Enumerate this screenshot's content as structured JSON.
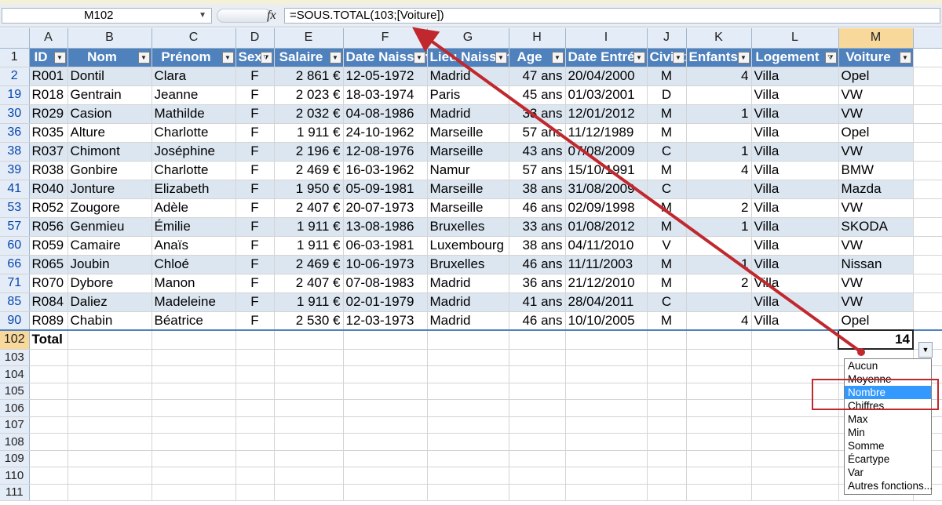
{
  "formula_bar": {
    "name_box": "M102",
    "fx_icon": "fx",
    "formula": "=SOUS.TOTAL(103;[Voiture])"
  },
  "columns": [
    "A",
    "B",
    "C",
    "D",
    "E",
    "F",
    "G",
    "H",
    "I",
    "J",
    "K",
    "L",
    "M"
  ],
  "header_row": {
    "row_number": "1",
    "labels": [
      "ID",
      "Nom",
      "Prénom",
      "Sexe",
      "Salaire",
      "Date Naissance",
      "Lieu Naissance",
      "Age",
      "Date Entrée",
      "Civilité",
      "Enfants",
      "Logement",
      "Voiture"
    ]
  },
  "rows": [
    {
      "row": "2",
      "cells": [
        "R001",
        "Dontil",
        "Clara",
        "F",
        "2 861 €",
        "12-05-1972",
        "Madrid",
        "47 ans",
        "20/04/2000",
        "M",
        "4",
        "Villa",
        "Opel"
      ]
    },
    {
      "row": "19",
      "cells": [
        "R018",
        "Gentrain",
        "Jeanne",
        "F",
        "2 023 €",
        "18-03-1974",
        "Paris",
        "45 ans",
        "01/03/2001",
        "D",
        "",
        "Villa",
        "VW"
      ]
    },
    {
      "row": "30",
      "cells": [
        "R029",
        "Casion",
        "Mathilde",
        "F",
        "2 032 €",
        "04-08-1986",
        "Madrid",
        "33 ans",
        "12/01/2012",
        "M",
        "1",
        "Villa",
        "VW"
      ]
    },
    {
      "row": "36",
      "cells": [
        "R035",
        "Alture",
        "Charlotte",
        "F",
        "1 911 €",
        "24-10-1962",
        "Marseille",
        "57 ans",
        "11/12/1989",
        "M",
        "",
        "Villa",
        "Opel"
      ]
    },
    {
      "row": "38",
      "cells": [
        "R037",
        "Chimont",
        "Joséphine",
        "F",
        "2 196 €",
        "12-08-1976",
        "Marseille",
        "43 ans",
        "07/08/2009",
        "C",
        "1",
        "Villa",
        "VW"
      ]
    },
    {
      "row": "39",
      "cells": [
        "R038",
        "Gonbire",
        "Charlotte",
        "F",
        "2 469 €",
        "16-03-1962",
        "Namur",
        "57 ans",
        "15/10/1991",
        "M",
        "4",
        "Villa",
        "BMW"
      ]
    },
    {
      "row": "41",
      "cells": [
        "R040",
        "Jonture",
        "Elizabeth",
        "F",
        "1 950 €",
        "05-09-1981",
        "Marseille",
        "38 ans",
        "31/08/2009",
        "C",
        "",
        "Villa",
        "Mazda"
      ]
    },
    {
      "row": "53",
      "cells": [
        "R052",
        "Zougore",
        "Adèle",
        "F",
        "2 407 €",
        "20-07-1973",
        "Marseille",
        "46 ans",
        "02/09/1998",
        "M",
        "2",
        "Villa",
        "VW"
      ]
    },
    {
      "row": "57",
      "cells": [
        "R056",
        "Genmieu",
        "Émilie",
        "F",
        "1 911 €",
        "13-08-1986",
        "Bruxelles",
        "33 ans",
        "01/08/2012",
        "M",
        "1",
        "Villa",
        "SKODA"
      ]
    },
    {
      "row": "60",
      "cells": [
        "R059",
        "Camaire",
        "Anaïs",
        "F",
        "1 911 €",
        "06-03-1981",
        "Luxembourg",
        "38 ans",
        "04/11/2010",
        "V",
        "",
        "Villa",
        "VW"
      ]
    },
    {
      "row": "66",
      "cells": [
        "R065",
        "Joubin",
        "Chloé",
        "F",
        "2 469 €",
        "10-06-1973",
        "Bruxelles",
        "46 ans",
        "11/11/2003",
        "M",
        "1",
        "Villa",
        "Nissan"
      ]
    },
    {
      "row": "71",
      "cells": [
        "R070",
        "Dybore",
        "Manon",
        "F",
        "2 407 €",
        "07-08-1983",
        "Madrid",
        "36 ans",
        "21/12/2010",
        "M",
        "2",
        "Villa",
        "VW"
      ]
    },
    {
      "row": "85",
      "cells": [
        "R084",
        "Daliez",
        "Madeleine",
        "F",
        "1 911 €",
        "02-01-1979",
        "Madrid",
        "41 ans",
        "28/04/2011",
        "C",
        "",
        "Villa",
        "VW"
      ]
    },
    {
      "row": "90",
      "cells": [
        "R089",
        "Chabin",
        "Béatrice",
        "F",
        "2 530 €",
        "12-03-1973",
        "Madrid",
        "46 ans",
        "10/10/2005",
        "M",
        "4",
        "Villa",
        "Opel"
      ]
    }
  ],
  "total_row": {
    "row": "102",
    "label": "Total",
    "value": "14"
  },
  "empty_rows": [
    "103",
    "104",
    "105",
    "106",
    "107",
    "108",
    "109",
    "110",
    "111"
  ],
  "total_dropdown": {
    "options": [
      "Aucun",
      "Moyenne",
      "Nombre",
      "Chiffres",
      "Max",
      "Min",
      "Somme",
      "Écartype",
      "Var",
      "Autres fonctions..."
    ],
    "highlighted": "Nombre"
  },
  "colors": {
    "header_blue": "#4f81bd",
    "band_blue": "#dce6f1",
    "annotation_red": "#c0282d",
    "highlight": "#3399ff",
    "selected_header": "#f9d99b"
  }
}
